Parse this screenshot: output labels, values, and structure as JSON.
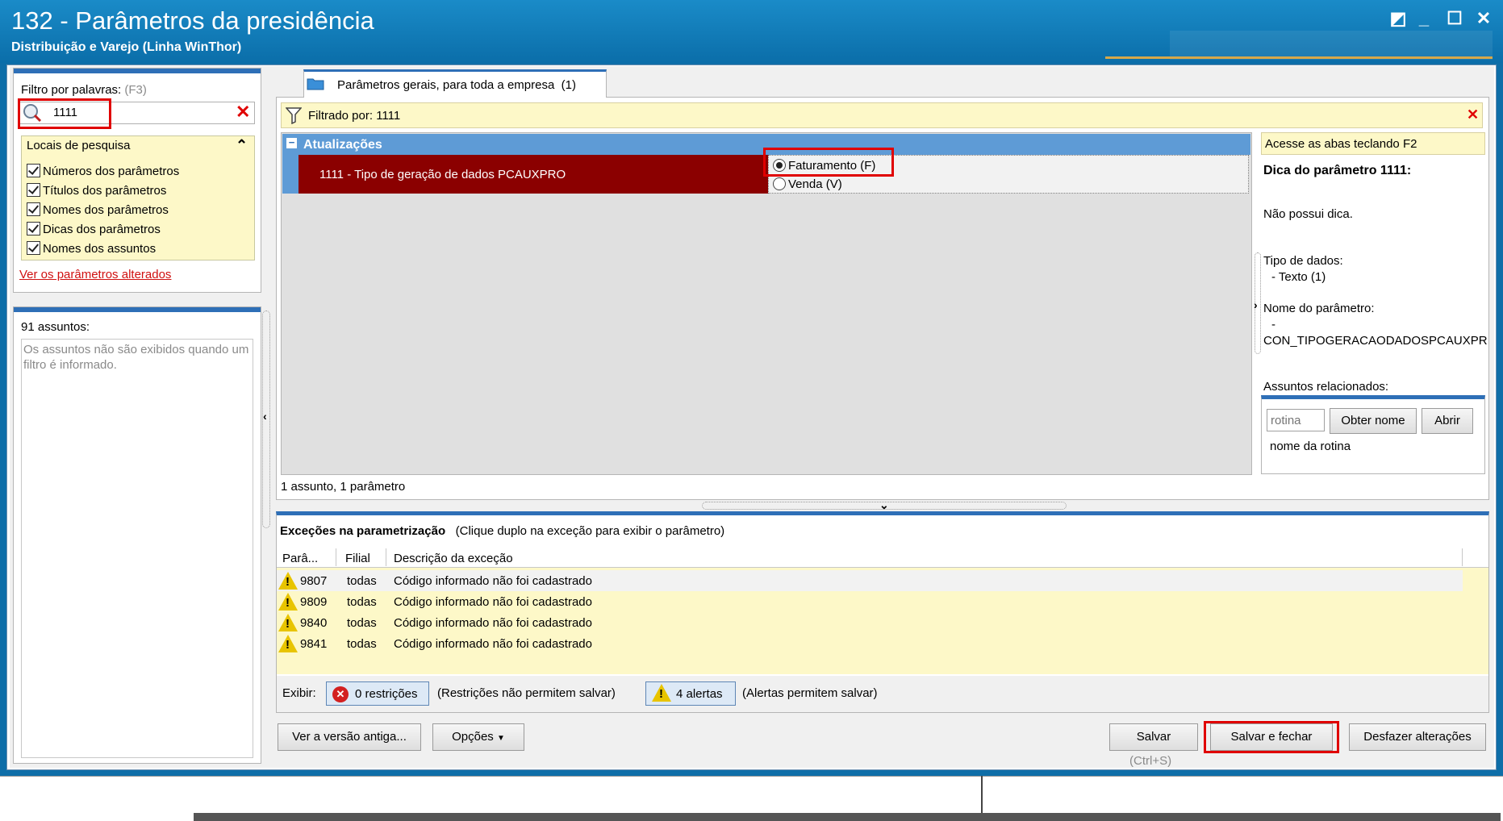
{
  "window": {
    "title": "132 - Parâmetros da presidência",
    "subtitle": "Distribuição e Varejo (Linha WinThor)",
    "controls": {
      "restore": "◩",
      "minimize": "_",
      "maximize": "☐",
      "close": "✕"
    }
  },
  "filter": {
    "label": "Filtro por palavras:",
    "shortcut": "(F3)",
    "value": "1111",
    "clear_icon": "✕",
    "locais_title": "Locais de pesquisa",
    "collapse_icon": "⌃",
    "options": [
      "Números dos parâmetros",
      "Títulos dos parâmetros",
      "Nomes dos parâmetros",
      "Dicas dos parâmetros",
      "Nomes dos assuntos"
    ],
    "changed_link": "Ver os parâmetros alterados"
  },
  "subjects": {
    "count_label": "91 assuntos:",
    "hint": "Os assuntos não são exibidos quando um filtro é informado."
  },
  "tab": {
    "label": "Parâmetros gerais, para toda a empresa",
    "count": "(1)"
  },
  "filter_bar": {
    "text": "Filtrado por: 1111",
    "close_icon": "✕"
  },
  "grid": {
    "group_toggle": "−",
    "group": "Atualizações",
    "param_label": "1111 - Tipo de geração de dados PCAUXPRO",
    "options": [
      {
        "label": "Faturamento (F)",
        "selected": true
      },
      {
        "label": "Venda (V)",
        "selected": false
      }
    ],
    "summary": "1 assunto, 1 parâmetro"
  },
  "tips": {
    "header": "Acesse as abas teclando F2",
    "title": "Dica do parâmetro 1111:",
    "body": "Não possui dica.",
    "data_type_label": "Tipo de dados:",
    "data_type_value": "- Texto (1)",
    "name_label": "Nome do parâmetro:",
    "name_dash": "-",
    "name_value": "CON_TIPOGERACAODADOSPCAUXPR",
    "related_label": "Assuntos relacionados:",
    "rotina_placeholder": "rotina",
    "obter_nome": "Obter nome",
    "abrir": "Abrir",
    "rotina_name": "nome da rotina"
  },
  "exceptions": {
    "title": "Exceções na parametrização",
    "hint": "(Clique duplo na exceção para exibir o parâmetro)",
    "columns": [
      "Parâ...",
      "Filial",
      "Descrição da exceção"
    ],
    "rows": [
      {
        "param": "9807",
        "filial": "todas",
        "desc": "Código informado não foi cadastrado"
      },
      {
        "param": "9809",
        "filial": "todas",
        "desc": "Código informado não foi cadastrado"
      },
      {
        "param": "9840",
        "filial": "todas",
        "desc": "Código informado não foi cadastrado"
      },
      {
        "param": "9841",
        "filial": "todas",
        "desc": "Código informado não foi cadastrado"
      }
    ],
    "exibir_label": "Exibir:",
    "restricoes": "0 restrições",
    "restricoes_hint": "(Restrições não permitem salvar)",
    "alertas": "4 alertas",
    "alertas_hint": "(Alertas permitem salvar)"
  },
  "actions": {
    "versao_antiga": "Ver a versão antiga...",
    "opcoes": "Opções",
    "salvar": "Salvar",
    "salvar_shortcut": "(Ctrl+S)",
    "salvar_fechar": "Salvar e fechar",
    "desfazer": "Desfazer alterações"
  },
  "colors": {
    "accent": "#2e6fb7",
    "title_bar": "#0e6ea8",
    "param_row": "#8b0000",
    "highlight_box": "#e00000",
    "yellow_panel": "#fdf8c8"
  }
}
